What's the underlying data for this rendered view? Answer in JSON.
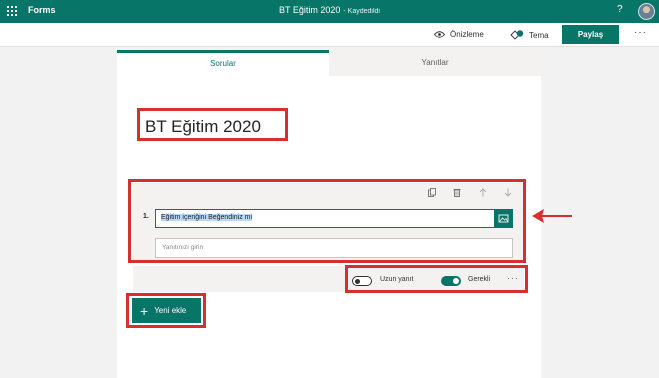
{
  "topbar": {
    "app_name": "Forms",
    "doc_title": "BT Eğitim 2020",
    "saved_status": "- Kaydedildi",
    "help_icon": "?"
  },
  "commandbar": {
    "preview_label": "Önizleme",
    "theme_label": "Tema",
    "share_label": "Paylaş",
    "more_label": "···"
  },
  "tabs": {
    "questions": "Sorular",
    "answers": "Yanıtlar"
  },
  "form": {
    "title": "BT Eğitim 2020"
  },
  "question": {
    "number": "1.",
    "text": "Eğitim içeriğini Beğendiniz mi",
    "answer_placeholder": "Yanıtınızı girin",
    "long_answer_label": "Uzun yanıt",
    "long_answer_enabled": false,
    "required_label": "Gerekli",
    "required_enabled": true,
    "more_label": "···"
  },
  "add_button_label": "Yeni ekle",
  "colors": {
    "brand": "#077568",
    "annotation": "#d62f2f",
    "selection": "#b9d7f7"
  },
  "icons": [
    "waffle-icon",
    "help-icon",
    "avatar",
    "eye-icon",
    "theme-icon",
    "copy-icon",
    "trash-icon",
    "arrow-up-icon",
    "arrow-down-icon",
    "image-icon",
    "plus-icon",
    "more-icon"
  ]
}
